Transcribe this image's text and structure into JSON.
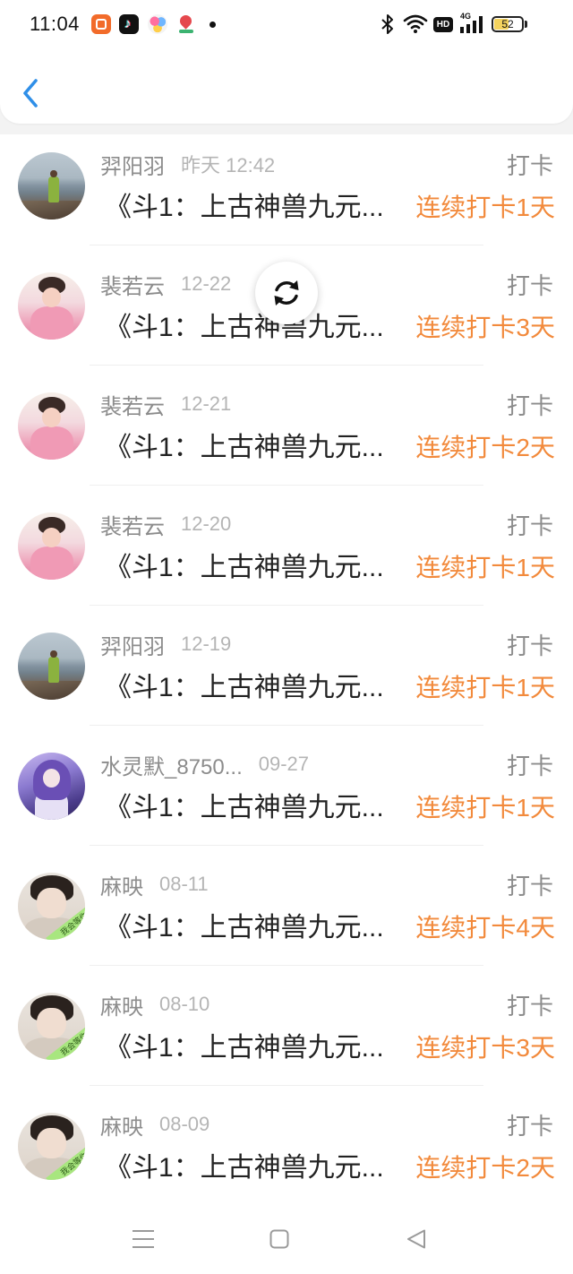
{
  "status_bar": {
    "time": "11:04",
    "app_icons": [
      "kuaishou-app-icon",
      "tiktok-app-icon",
      "flower-app-icon",
      "map-pin-app-icon"
    ],
    "system_icons": [
      "bluetooth-icon",
      "wifi-icon",
      "hd-badge",
      "cellular-signal-icon",
      "battery-icon"
    ],
    "hd_label": "HD",
    "network_label": "4G",
    "battery_label": "52",
    "battery_level": 0.52
  },
  "header": {
    "back_icon": "chevron-left-icon"
  },
  "refresh_button": {
    "icon": "refresh-icon"
  },
  "colors": {
    "accent": "#2f8fe8",
    "streak": "#f28a3c",
    "name": "#8c8c8c",
    "time": "#b5b5b5",
    "title": "#222222",
    "battery_fill": "#f4d35e"
  },
  "checkins": [
    {
      "name": "羿阳羽",
      "time": "昨天 12:42",
      "action": "打卡",
      "title": "《斗1：上古神兽九元...",
      "streak": "连续打卡1天",
      "avatar": "lake-photo"
    },
    {
      "name": "裴若云",
      "time": "12-22",
      "action": "打卡",
      "title": "《斗1：上古神兽九元...",
      "streak": "连续打卡3天",
      "avatar": "pink-portrait"
    },
    {
      "name": "裴若云",
      "time": "12-21",
      "action": "打卡",
      "title": "《斗1：上古神兽九元...",
      "streak": "连续打卡2天",
      "avatar": "pink-portrait"
    },
    {
      "name": "裴若云",
      "time": "12-20",
      "action": "打卡",
      "title": "《斗1：上古神兽九元...",
      "streak": "连续打卡1天",
      "avatar": "pink-portrait"
    },
    {
      "name": "羿阳羽",
      "time": "12-19",
      "action": "打卡",
      "title": "《斗1：上古神兽九元...",
      "streak": "连续打卡1天",
      "avatar": "lake-photo"
    },
    {
      "name": "水灵默_8750...",
      "time": "09-27",
      "action": "打卡",
      "title": "《斗1：上古神兽九元...",
      "streak": "连续打卡1天",
      "avatar": "anime-portrait"
    },
    {
      "name": "麻映",
      "time": "08-11",
      "action": "打卡",
      "title": "《斗1：上古神兽九元...",
      "streak": "连续打卡4天",
      "avatar": "boy-portrait",
      "avatar_caption": "我会等你"
    },
    {
      "name": "麻映",
      "time": "08-10",
      "action": "打卡",
      "title": "《斗1：上古神兽九元...",
      "streak": "连续打卡3天",
      "avatar": "boy-portrait",
      "avatar_caption": "我会等你"
    },
    {
      "name": "麻映",
      "time": "08-09",
      "action": "打卡",
      "title": "《斗1：上古神兽九元...",
      "streak": "连续打卡2天",
      "avatar": "boy-portrait",
      "avatar_caption": "我会等你"
    }
  ],
  "nav_bar": {
    "icons": [
      "menu-icon",
      "home-square-icon",
      "back-triangle-icon"
    ]
  }
}
